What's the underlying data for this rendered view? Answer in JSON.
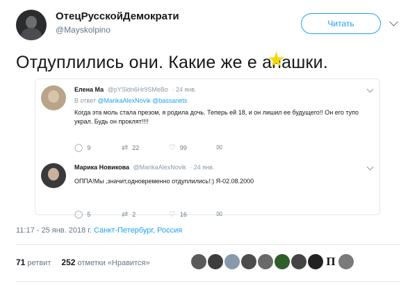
{
  "author": {
    "name": "ОтецРусскойДемократи",
    "handle": "@Mayskolpino",
    "follow_label": "Читать"
  },
  "tweet_text": "Отдуплились они. Какие же е анашки.",
  "replies": [
    {
      "name": "Елена Ма",
      "handle": "@pYSldn6Hr9SMeBo",
      "time": "· 24 янв.",
      "reply_to_prefix": "В ответ",
      "reply_to_links": "@MarikaAlexNovik @bassanets",
      "text": "Когда эта моль стала презом, я родила дочь. Теперь ей 18, и он лишил ее будущего!! Он его тупо украл. Будь он проклят!!!!",
      "reply_count": "9",
      "retweet_count": "22",
      "like_count": "99"
    },
    {
      "name": "Марика Новикова",
      "handle": "@MarikaAlexNovik",
      "time": "· 24 янв.",
      "text": "ОППА!Мы ,значит,одновременно отдуплились!:) Я-02.08.2000",
      "reply_count": "5",
      "retweet_count": "2",
      "like_count": "16"
    }
  ],
  "timestamp": {
    "time": "11:17 - 25 янв. 2018 г.",
    "location": "Санкт-Петербург, Россия"
  },
  "stats": {
    "retweets_count": "71",
    "retweets_label": "ретвит",
    "likes_count": "252",
    "likes_label": "отметки «Нравится»"
  },
  "likers": [
    "#5a5a5a",
    "#3d3d3d",
    "#8899aa",
    "#4c4c4c",
    "#6a6a6a",
    "#2f5e2a",
    "#444444",
    "#222222",
    "П",
    "#7a7a7a"
  ],
  "colors": {
    "accent": "#1da1f2",
    "emoji_star": "#f5d90a"
  }
}
